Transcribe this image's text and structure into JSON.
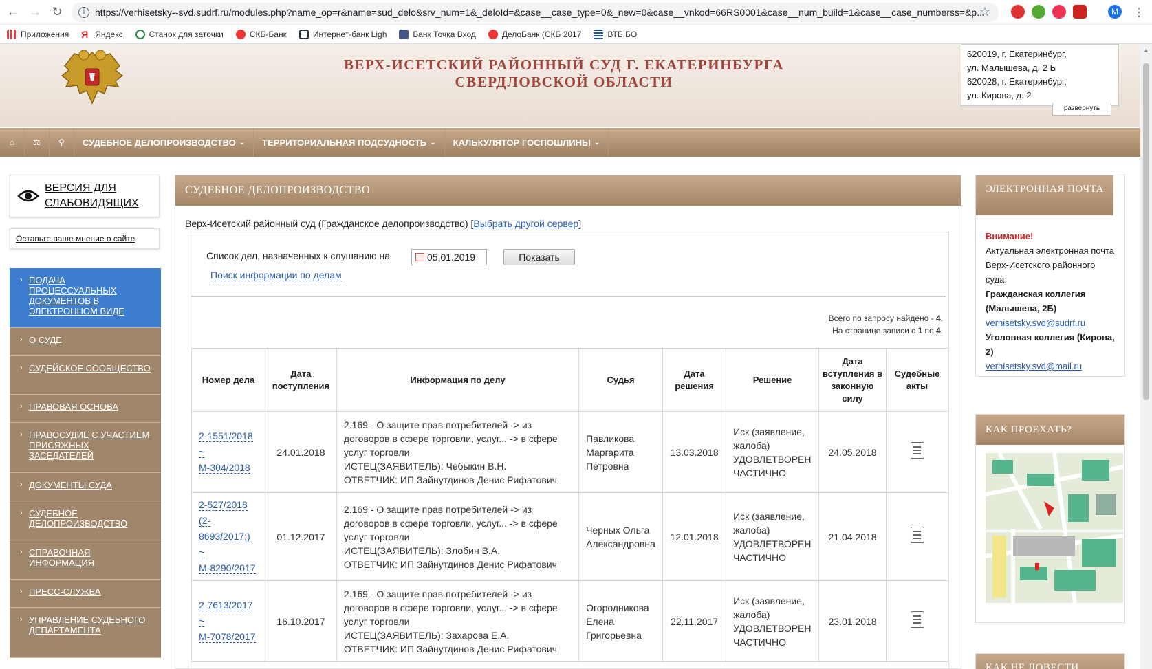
{
  "browser": {
    "url": "https://verhisetsky--svd.sudrf.ru/modules.php?name_op=r&name=sud_delo&srv_num=1&_deloId=&case__case_type=0&_new=0&case__vnkod=66RS0001&case__num_build=1&case__case_numberss=&p...",
    "profile_initial": "M",
    "bookmarks": [
      "Приложения",
      "Яндекс",
      "Станок для заточки",
      "СКБ-Банк",
      "Интернет-банк Ligh",
      "Банк Точка Вход",
      "ДелоБанк (СКБ 2017",
      "ВТБ БО"
    ]
  },
  "header": {
    "title_line1": "ВЕРХ-ИСЕТСКИЙ РАЙОННЫЙ СУД Г. ЕКАТЕРИНБУРГА",
    "title_line2": "СВЕРДЛОВСКОЙ ОБЛАСТИ",
    "address_lines": [
      "620019, г. Екатеринбург,",
      "ул. Малышева, д. 2 Б",
      "620028, г. Екатеринбург,",
      "ул. Кирова, д. 2"
    ],
    "expand_label": "развернуть"
  },
  "nav": {
    "items": [
      "СУДЕБНОЕ ДЕЛОПРОИЗВОДСТВО",
      "ТЕРРИТОРИАЛЬНАЯ ПОДСУДНОСТЬ",
      "КАЛЬКУЛЯТОР ГОСПОШЛИНЫ"
    ]
  },
  "sidebar": {
    "vision_line1": "ВЕРСИЯ ДЛЯ",
    "vision_line2": "СЛАБОВИДЯЩИХ",
    "feedback": "Оставьте ваше мнение о сайте",
    "menu": [
      {
        "label": "ПОДАЧА ПРОЦЕССУАЛЬНЫХ ДОКУМЕНТОВ В ЭЛЕКТРОННОМ ВИДЕ",
        "active": true
      },
      {
        "label": "О СУДЕ",
        "active": false
      },
      {
        "label": "СУДЕЙСКОЕ СООБЩЕСТВО",
        "active": false
      },
      {
        "label": "ПРАВОВАЯ ОСНОВА",
        "active": false
      },
      {
        "label": "ПРАВОСУДИЕ С УЧАСТИЕМ ПРИСЯЖНЫХ ЗАСЕДАТЕЛЕЙ",
        "active": false
      },
      {
        "label": "ДОКУМЕНТЫ СУДА",
        "active": false
      },
      {
        "label": "СУДЕБНОЕ ДЕЛОПРОИЗВОДСТВО",
        "active": false
      },
      {
        "label": "СПРАВОЧНАЯ ИНФОРМАЦИЯ",
        "active": false
      },
      {
        "label": "ПРЕСС-СЛУЖБА",
        "active": false
      },
      {
        "label": "УПРАВЛЕНИЕ СУДЕБНОГО ДЕПАРТАМЕНТА",
        "active": false
      }
    ]
  },
  "main": {
    "panel_title": "СУДЕБНОЕ ДЕЛОПРОИЗВОДСТВО",
    "server_text": "Верх-Исетский районный суд (Гражданское делопроизводство) [",
    "server_link": "Выбрать другой сервер",
    "server_close": "]",
    "list_label": "Список дел, назначенных к слушанию на",
    "date_value": "05.01.2019",
    "show_button": "Показать",
    "search_link": "Поиск информации по делам",
    "total_line1_prefix": "Всего по запросу найдено - ",
    "total_found": "4",
    "total_line2_prefix": "На странице записи с ",
    "total_from": "1",
    "total_mid": " по ",
    "total_to": "4",
    "columns": [
      "Номер дела",
      "Дата поступления",
      "Информация по делу",
      "Судья",
      "Дата решения",
      "Решение",
      "Дата вступления в законную силу",
      "Судебные акты"
    ],
    "rows": [
      {
        "number": "2-1551/2018 ~ М-304/2018",
        "received": "24.01.2018",
        "info": [
          "2.169 - О защите прав потребителей -> из договоров в сфере торговли, услуг... -> в сфере услуг торговли",
          "ИСТЕЦ(ЗАЯВИТЕЛЬ): Чебыкин В.Н.",
          "ОТВЕТЧИК: ИП Зайнутдинов Денис Рифатович"
        ],
        "judge": "Павликова Маргарита Петровна",
        "decision_date": "13.03.2018",
        "decision": "Иск (заявление, жалоба) УДОВЛЕТВОРЕН ЧАСТИЧНО",
        "effective": "24.05.2018"
      },
      {
        "number": "2-527/2018 (2-8693/2017;) ~ М-8290/2017",
        "received": "01.12.2017",
        "info": [
          "2.169 - О защите прав потребителей -> из договоров в сфере торговли, услуг... -> в сфере услуг торговли",
          "ИСТЕЦ(ЗАЯВИТЕЛЬ): Злобин В.А.",
          "ОТВЕТЧИК: ИП Зайнутдинов Денис Рифатович"
        ],
        "judge": "Черных Ольга Александровна",
        "decision_date": "12.01.2018",
        "decision": "Иск (заявление, жалоба) УДОВЛЕТВОРЕН ЧАСТИЧНО",
        "effective": "21.04.2018"
      },
      {
        "number": "2-7613/2017 ~ М-7078/2017",
        "received": "16.10.2017",
        "info": [
          "2.169 - О защите прав потребителей -> из договоров в сфере торговли, услуг... -> в сфере услуг торговли",
          "ИСТЕЦ(ЗАЯВИТЕЛЬ): Захарова Е.А.",
          "ОТВЕТЧИК: ИП Зайнутдинов Денис Рифатович"
        ],
        "judge": "Огородникова Елена Григорьевна",
        "decision_date": "22.11.2017",
        "decision": "Иск (заявление, жалоба) УДОВЛЕТВОРЕН ЧАСТИЧНО",
        "effective": "23.01.2018"
      }
    ]
  },
  "right": {
    "email_title": "ЭЛЕКТРОННАЯ ПОЧТА",
    "warning": "Внимание!",
    "email_text": "Актуальная электронная почта Верх-Исетского районного суда:",
    "civil_label": "Гражданская коллегия (Малышева, 2Б)",
    "civil_email": "verhisetsky.svd@sudrf.ru",
    "criminal_label": "Уголовная коллегия (Кирова, 2)",
    "criminal_email": "verhisetsky.svd@mail.ru",
    "route_title": "КАК ПРОЕХАТЬ?",
    "third_title": "КАК НЕ ДОВЕСТИ"
  }
}
